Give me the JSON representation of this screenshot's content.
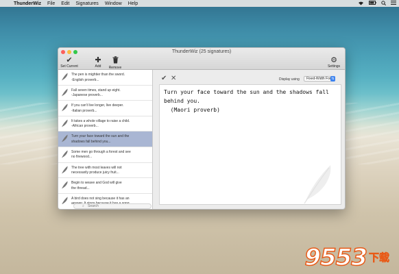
{
  "menubar": {
    "app": "ThunderWiz",
    "items": [
      "File",
      "Edit",
      "Signatures",
      "Window",
      "Help"
    ],
    "status_icons": [
      "wifi-icon",
      "battery-icon",
      "search-icon",
      "menu-icon"
    ]
  },
  "window": {
    "title": "ThunderWiz (25 signatures)"
  },
  "toolbar": {
    "set_current": "Set Current",
    "add": "Add",
    "remove": "Remove",
    "settings": "Settings"
  },
  "sidebar": {
    "items": [
      {
        "line1": "The pen is mightier than the sword.",
        "line2": "-English proverb..."
      },
      {
        "line1": "Fall seven times, stand up eight.",
        "line2": "-Japanese proverb..."
      },
      {
        "line1": "If you can't live longer, live deeper.",
        "line2": "-Italian proverb..."
      },
      {
        "line1": "It takes a whole village to raise a child.",
        "line2": "-African proverb..."
      },
      {
        "line1": "Turn your face toward the sun and the",
        "line2": "shadows fall behind you..."
      },
      {
        "line1": "Some men go through a forest and see",
        "line2": "no firewood..."
      },
      {
        "line1": "The tree with most leaves will not",
        "line2": "necessarily produce juicy fruit..."
      },
      {
        "line1": "Begin to weave and God will give",
        "line2": "the thread..."
      },
      {
        "line1": "A bird does not sing because it has an",
        "line2": "answer. It sings because it has a song"
      }
    ],
    "selected_index": 4,
    "search_placeholder": "Search"
  },
  "editor": {
    "display_label": "Display using",
    "display_value": "Fixed-Width Font",
    "text": "Turn your face toward the sun and the shadows fall\nbehind you.\n  (Maori proverb)"
  },
  "watermark": {
    "number": "9553",
    "chinese": "下载"
  },
  "colors": {
    "selected_row": "#a9b6d3",
    "accent": "#3d83f0"
  }
}
